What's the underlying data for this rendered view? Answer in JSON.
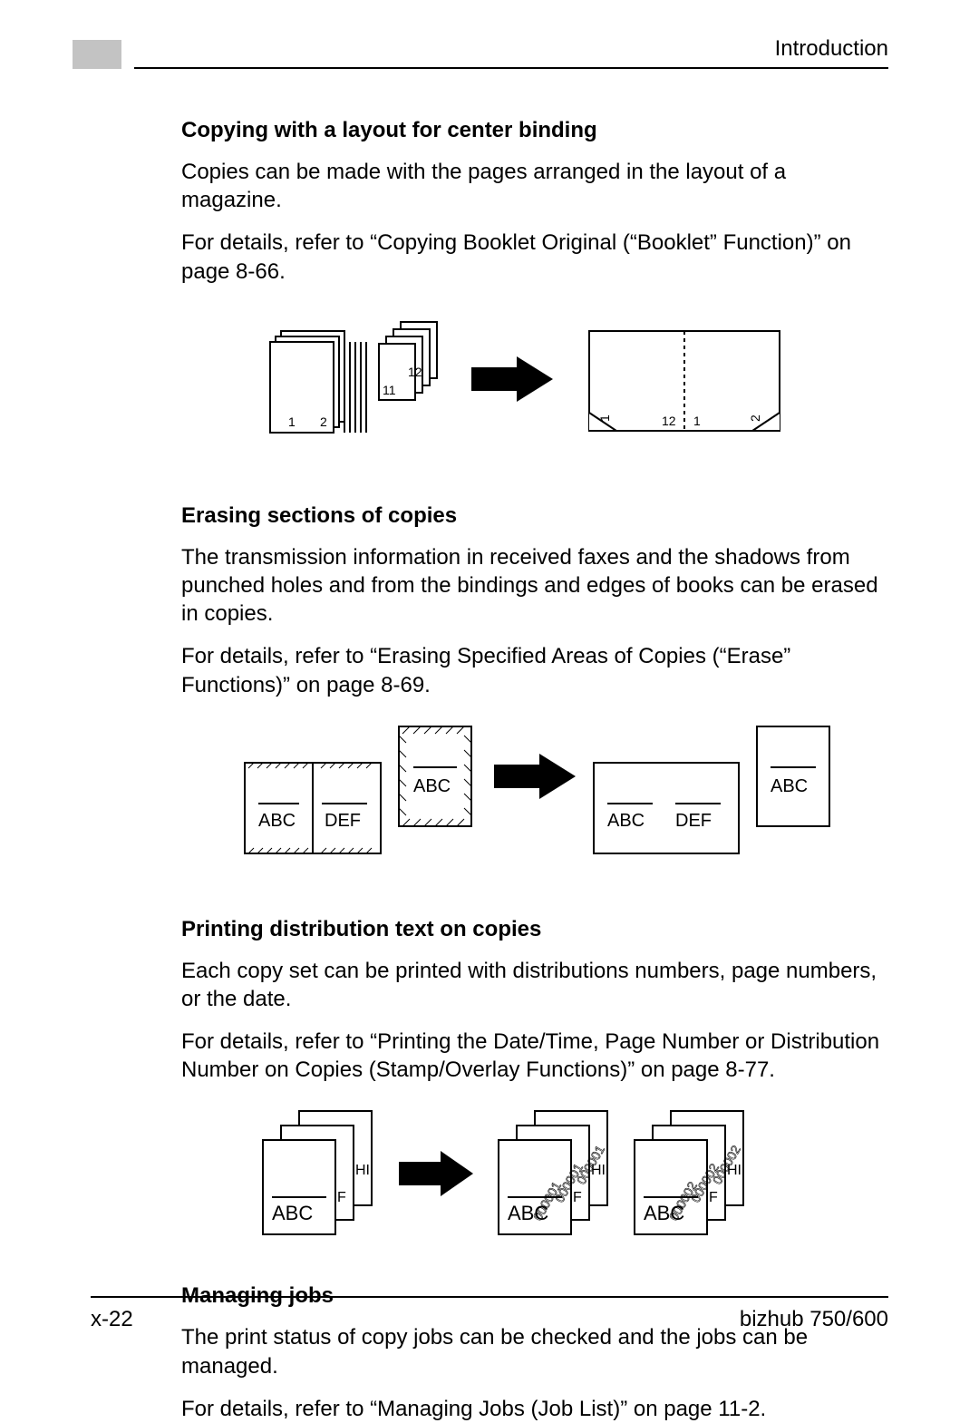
{
  "header": {
    "section_label": "Introduction"
  },
  "sections": {
    "s1": {
      "heading": "Copying with a layout for center binding",
      "p1": "Copies can be made with the pages arranged in the layout of a magazine.",
      "p2": "For details, refer to “Copying Booklet Original (“Booklet” Function)” on page 8-66."
    },
    "s2": {
      "heading": "Erasing sections of copies",
      "p1": "The transmission information in received faxes and the shadows from punched holes and from the bindings and edges of books can be erased in copies.",
      "p2": "For details, refer to “Erasing Specified Areas of Copies (“Erase” Functions)” on page 8-69."
    },
    "s3": {
      "heading": "Printing distribution text on copies",
      "p1": "Each copy set can be printed with distributions numbers, page numbers, or the date.",
      "p2": "For details, refer to “Printing the Date/Time, Page Number or Distribution Number on Copies (Stamp/Overlay Functions)” on page 8-77."
    },
    "s4": {
      "heading": "Managing jobs",
      "p1": "The print status of copy jobs can be checked and the jobs can be managed.",
      "p2": "For details, refer to “Managing Jobs (Job List)” on page 11-2."
    }
  },
  "figures": {
    "fig1": {
      "labels": {
        "a": "1",
        "b": "2",
        "c": "11",
        "d": "12",
        "e": "1",
        "f": "2",
        "g": "12",
        "h": "1"
      }
    },
    "fig2": {
      "labels": {
        "a": "ABC",
        "b": "DEF",
        "c": "ABC",
        "d": "ABC",
        "e": "DEF",
        "f": "ABC"
      }
    },
    "fig3": {
      "labels": {
        "a": "ABC",
        "af": "F",
        "ah": "HI",
        "b": "ABC",
        "bf": "F",
        "bh": "HI",
        "c": "ABC",
        "cf": "F",
        "ch": "HI",
        "n1": "000001",
        "n2": "000001",
        "n3": "000001",
        "m1": "000002",
        "m2": "000002",
        "m3": "000002"
      }
    }
  },
  "footer": {
    "page_number": "x-22",
    "product": "bizhub 750/600"
  }
}
